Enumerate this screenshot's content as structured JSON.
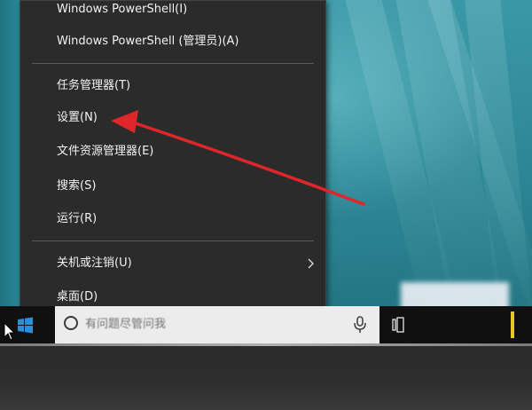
{
  "context_menu": {
    "items": [
      {
        "label": "Windows PowerShell(I)"
      },
      {
        "label": "Windows PowerShell (管理员)(A)"
      },
      {
        "label": "任务管理器(T)"
      },
      {
        "label": "设置(N)"
      },
      {
        "label": "文件资源管理器(E)"
      },
      {
        "label": "搜索(S)"
      },
      {
        "label": "运行(R)"
      },
      {
        "label": "关机或注销(U)",
        "submenu_icon": "chevron-right-icon"
      },
      {
        "label": "桌面(D)"
      }
    ]
  },
  "taskbar": {
    "search_placeholder": "有问题尽管问我",
    "icons": [
      "windows-start-icon",
      "cortana-icon",
      "microphone-icon",
      "task-view-icon"
    ]
  },
  "annotation": {
    "arrow_color": "#e0262b",
    "points_to": "设置(N)"
  },
  "colors": {
    "menu_background": "#2b2b2b",
    "menu_text": "#f2f2f2",
    "desktop_teal": "#2a8593",
    "taskbar": "#101010"
  }
}
